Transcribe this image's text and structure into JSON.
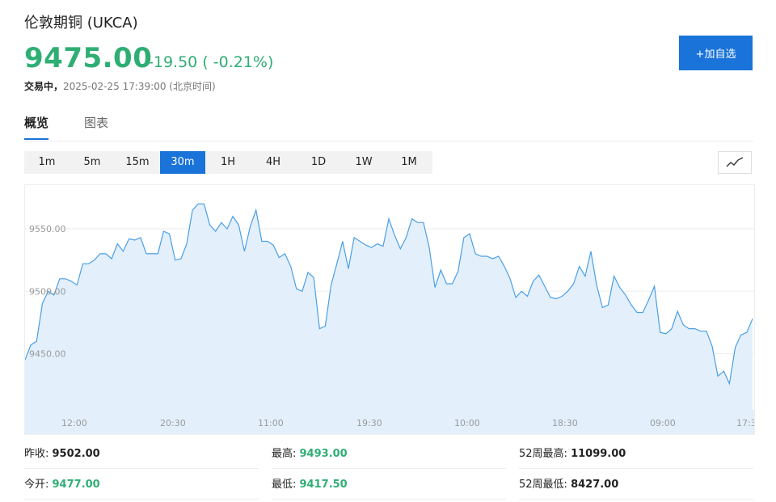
{
  "header": {
    "title": "伦敦期铜 (UKCA)",
    "price": "9475.00",
    "change": "-19.50 ( -0.21%)",
    "status_label": "交易中，",
    "timestamp": "2025-02-25 17:39:00 (北京时间)",
    "add_button": "+加自选"
  },
  "tabs": [
    {
      "label": "概览",
      "active": true
    },
    {
      "label": "图表",
      "active": false
    }
  ],
  "periods": [
    "1m",
    "5m",
    "15m",
    "30m",
    "1H",
    "4H",
    "1D",
    "1W",
    "1M"
  ],
  "active_period": "30m",
  "chart_type_icon": "line-chart-icon",
  "colors": {
    "up_down_green": "#2fae74",
    "accent": "#1a73d9",
    "area_fill": "#e3f0fc",
    "line": "#4a9ee6"
  },
  "chart_data": {
    "type": "area",
    "y_ticks": [
      "9550.00",
      "9500.00",
      "9450.00"
    ],
    "x_ticks": [
      "12:00",
      "20:30",
      "11:00",
      "19:30",
      "10:00",
      "18:30",
      "09:00",
      "17:3"
    ],
    "ylim": [
      9405,
      9585
    ],
    "values": [
      9445,
      9457,
      9460,
      9490,
      9500,
      9497,
      9510,
      9510,
      9508,
      9505,
      9522,
      9522,
      9525,
      9530,
      9530,
      9526,
      9538,
      9532,
      9542,
      9541,
      9543,
      9530,
      9530,
      9530,
      9548,
      9546,
      9525,
      9526,
      9538,
      9565,
      9570,
      9570,
      9553,
      9548,
      9555,
      9550,
      9560,
      9553,
      9532,
      9552,
      9565,
      9540,
      9540,
      9537,
      9527,
      9530,
      9520,
      9502,
      9500,
      9515,
      9511,
      9470,
      9472,
      9505,
      9522,
      9540,
      9518,
      9543,
      9540,
      9537,
      9535,
      9538,
      9536,
      9558,
      9545,
      9534,
      9543,
      9558,
      9555,
      9555,
      9535,
      9503,
      9517,
      9506,
      9506,
      9516,
      9543,
      9546,
      9530,
      9528,
      9528,
      9526,
      9528,
      9520,
      9510,
      9495,
      9500,
      9496,
      9508,
      9513,
      9504,
      9495,
      9494,
      9496,
      9500,
      9506,
      9520,
      9512,
      9532,
      9505,
      9487,
      9489,
      9512,
      9503,
      9497,
      9489,
      9483,
      9483,
      9493,
      9504,
      9467,
      9466,
      9470,
      9484,
      9473,
      9470,
      9470,
      9468,
      9468,
      9456,
      9432,
      9436,
      9426,
      9455,
      9465,
      9467,
      9478
    ]
  },
  "stats": [
    {
      "label": "昨收:",
      "value": "9502.00",
      "color": "dark"
    },
    {
      "label": "最高:",
      "value": "9493.00",
      "color": "green"
    },
    {
      "label": "52周最高:",
      "value": "11099.00",
      "color": "dark"
    },
    {
      "label": "今开:",
      "value": "9477.00",
      "color": "green"
    },
    {
      "label": "最低:",
      "value": "9417.50",
      "color": "green"
    },
    {
      "label": "52周最低:",
      "value": "8427.00",
      "color": "dark"
    }
  ]
}
